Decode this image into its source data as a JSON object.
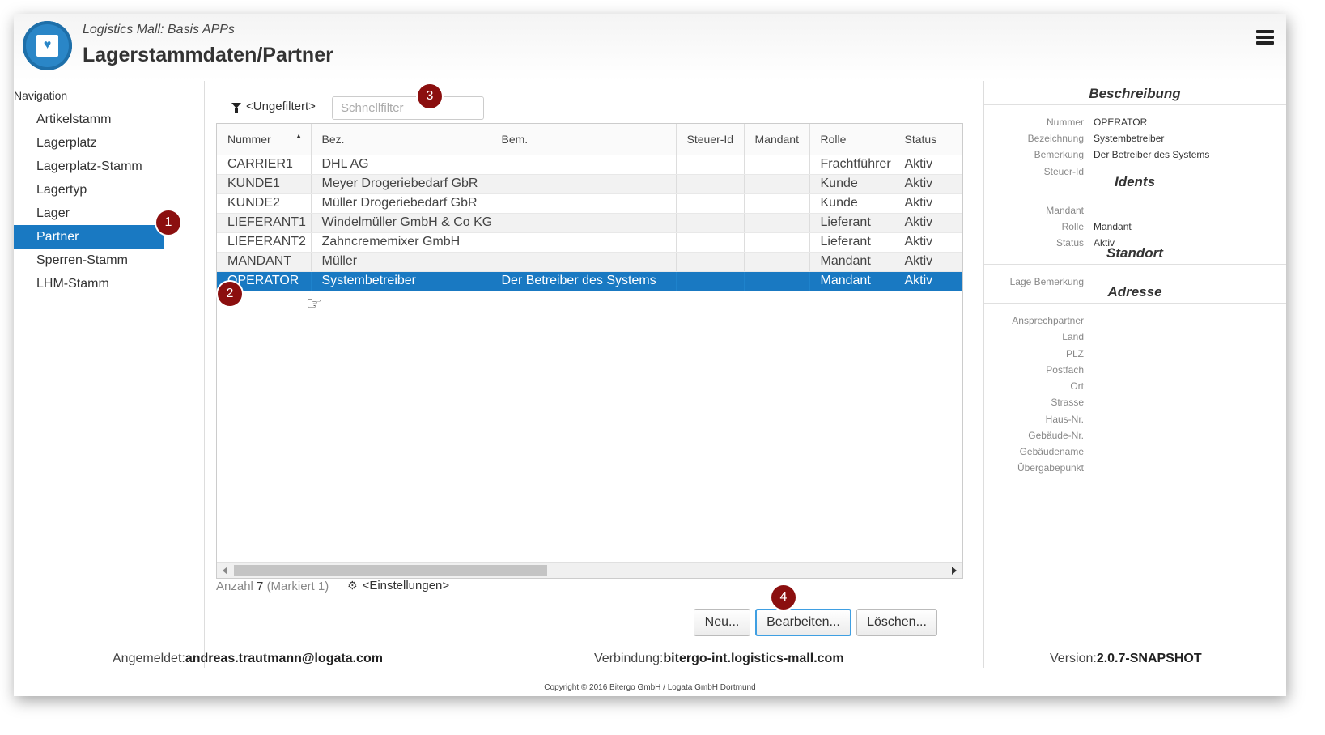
{
  "header": {
    "app_name": "Logistics Mall: Basis APPs",
    "title": "Lagerstammdaten/Partner"
  },
  "nav": {
    "title": "Navigation",
    "items": [
      {
        "label": "Artikelstamm"
      },
      {
        "label": "Lagerplatz"
      },
      {
        "label": "Lagerplatz-Stamm"
      },
      {
        "label": "Lagertyp"
      },
      {
        "label": "Lager"
      },
      {
        "label": "Partner",
        "active": true
      },
      {
        "label": "Sperren-Stamm"
      },
      {
        "label": "LHM-Stamm"
      }
    ]
  },
  "filter": {
    "label": "<Ungefiltert>",
    "placeholder": "Schnellfilter"
  },
  "table": {
    "columns": [
      "Nummer",
      "Bez.",
      "Bem.",
      "Steuer-Id",
      "Mandant",
      "Rolle",
      "Status"
    ],
    "rows": [
      [
        "CARRIER1",
        "DHL AG",
        "",
        "",
        "",
        "Frachtführer",
        "Aktiv"
      ],
      [
        "KUNDE1",
        "Meyer Drogeriebedarf GbR",
        "",
        "",
        "",
        "Kunde",
        "Aktiv"
      ],
      [
        "KUNDE2",
        "Müller Drogeriebedarf GbR",
        "",
        "",
        "",
        "Kunde",
        "Aktiv"
      ],
      [
        "LIEFERANT1",
        "Windelmüller GmbH & Co KG",
        "",
        "",
        "",
        "Lieferant",
        "Aktiv"
      ],
      [
        "LIEFERANT2",
        "Zahncrememixer GmbH",
        "",
        "",
        "",
        "Lieferant",
        "Aktiv"
      ],
      [
        "MANDANT",
        "Müller",
        "",
        "",
        "",
        "Mandant",
        "Aktiv"
      ],
      [
        "OPERATOR",
        "Systembetreiber",
        "Der Betreiber des Systems",
        "",
        "",
        "Mandant",
        "Aktiv"
      ]
    ],
    "selected_row": 6,
    "sorted_column": "Nummer"
  },
  "status": {
    "count_label": "Anzahl",
    "count": "7",
    "marked": "(Markiert 1)",
    "settings_label": "<Einstellungen>"
  },
  "buttons": {
    "new": "Neu...",
    "edit": "Bearbeiten...",
    "delete": "Löschen..."
  },
  "badges": [
    "1",
    "2",
    "3",
    "4"
  ],
  "detail": {
    "beschreibung": {
      "title": "Beschreibung",
      "fields": [
        {
          "label": "Nummer",
          "value": "OPERATOR"
        },
        {
          "label": "Bezeichnung",
          "value": "Systembetreiber"
        },
        {
          "label": "Bemerkung",
          "value": "Der Betreiber des Systems"
        },
        {
          "label": "Steuer-Id",
          "value": ""
        }
      ]
    },
    "idents": {
      "title": "Idents",
      "fields": [
        {
          "label": "Mandant",
          "value": ""
        },
        {
          "label": "Rolle",
          "value": "Mandant"
        },
        {
          "label": "Status",
          "value": "Aktiv"
        }
      ]
    },
    "standort": {
      "title": "Standort",
      "fields": [
        {
          "label": "Lage Bemerkung",
          "value": ""
        }
      ]
    },
    "adresse": {
      "title": "Adresse",
      "fields": [
        {
          "label": "Ansprechpartner",
          "value": ""
        },
        {
          "label": "Land",
          "value": ""
        },
        {
          "label": "PLZ",
          "value": ""
        },
        {
          "label": "Postfach",
          "value": ""
        },
        {
          "label": "Ort",
          "value": ""
        },
        {
          "label": "Strasse",
          "value": ""
        },
        {
          "label": "Haus-Nr.",
          "value": ""
        },
        {
          "label": "Gebäude-Nr.",
          "value": ""
        },
        {
          "label": "Gebäudename",
          "value": ""
        },
        {
          "label": "Übergabepunkt",
          "value": ""
        }
      ]
    }
  },
  "footer": {
    "logged_in_label": "Angemeldet:",
    "logged_in_user": "andreas.trautmann@logata.com",
    "connection_label": "Verbindung:",
    "connection_value": "bitergo-int.logistics-mall.com",
    "version_label": "Version:",
    "version_value": "2.0.7-SNAPSHOT",
    "copyright": "Copyright © 2016 Bitergo GmbH / Logata GmbH Dortmund"
  },
  "colors": {
    "accent": "#1979c2",
    "badge": "#8b0f0f",
    "logo": "#2a86c7"
  }
}
